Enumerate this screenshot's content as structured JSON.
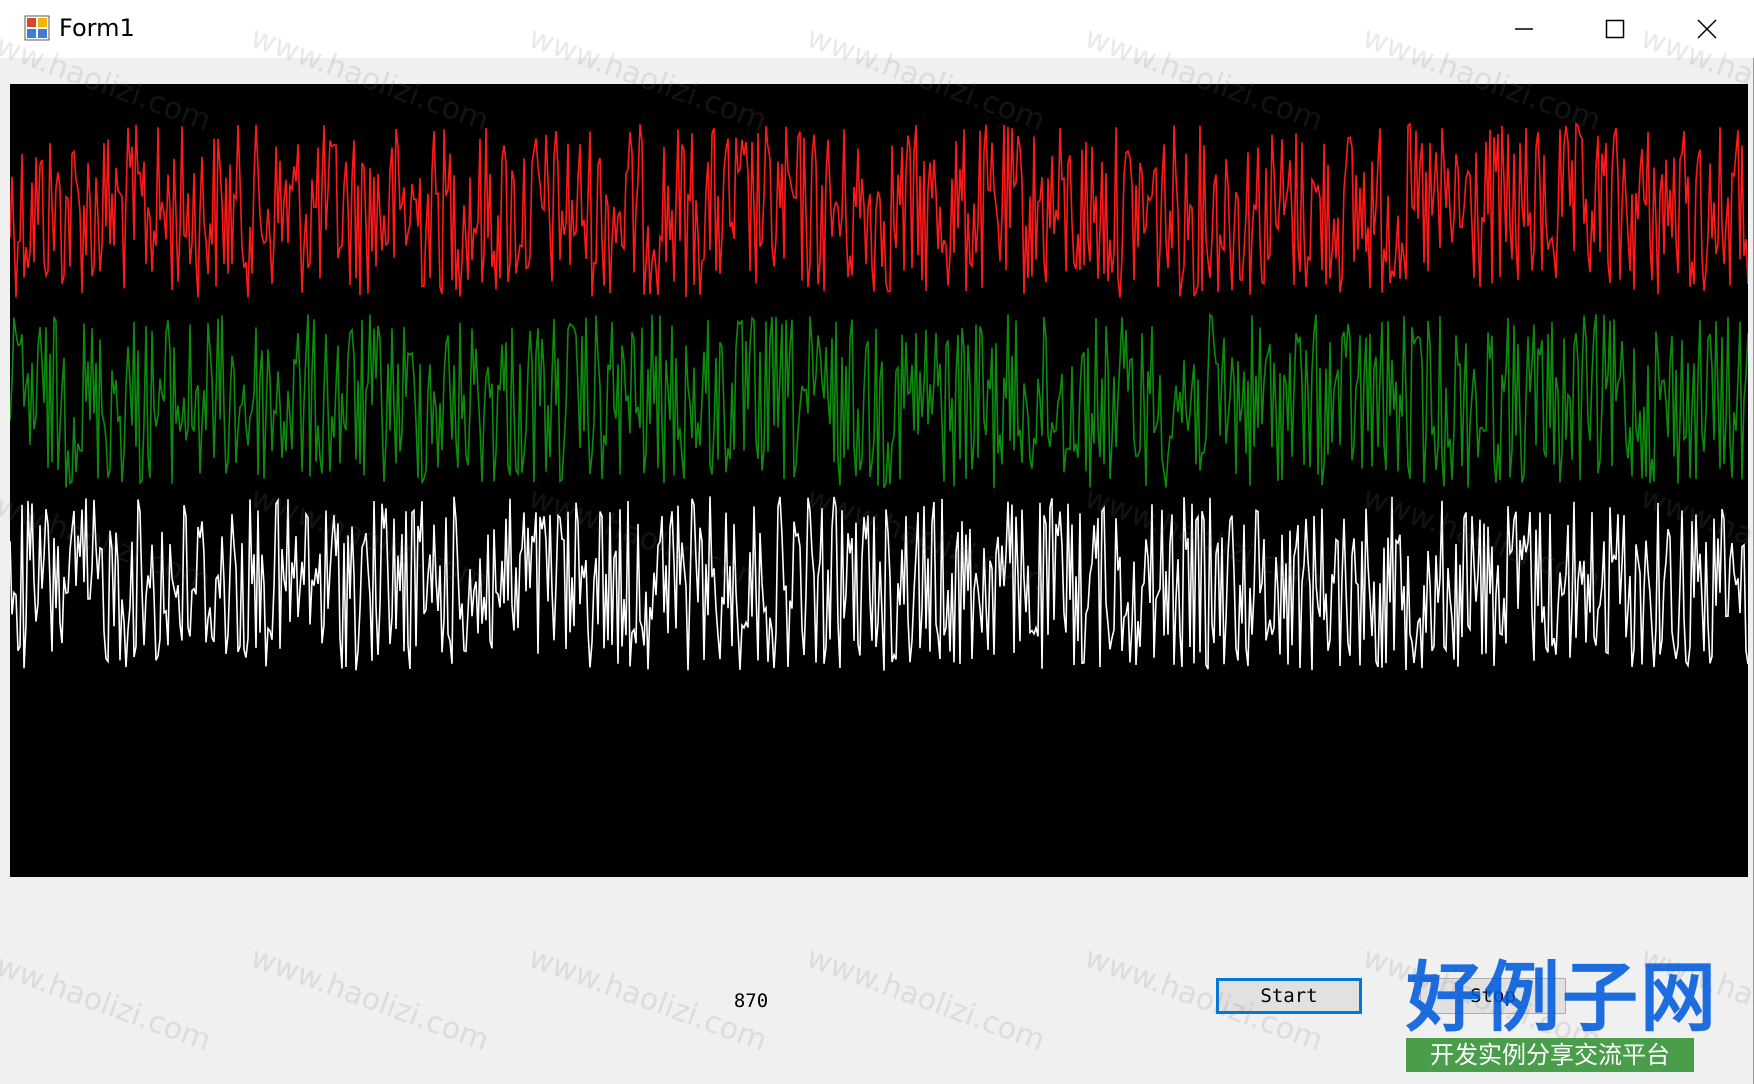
{
  "window": {
    "title": "Form1"
  },
  "titlebar_buttons": [
    {
      "name": "minimize",
      "icon": "minimize-icon"
    },
    {
      "name": "maximize",
      "icon": "maximize-icon"
    },
    {
      "name": "close",
      "icon": "close-icon"
    }
  ],
  "plot": {
    "background": "#000000",
    "series": [
      {
        "color": "#ff1a1a",
        "band_center": 0.16,
        "band_amplitude": 0.11
      },
      {
        "color": "#0e8a0e",
        "band_center": 0.4,
        "band_amplitude": 0.11
      },
      {
        "color": "#ffffff",
        "band_center": 0.63,
        "band_amplitude": 0.11
      }
    ]
  },
  "counter": {
    "value": "870"
  },
  "buttons": {
    "start_label": "Start",
    "stop_label": "Stop"
  },
  "watermark": {
    "text": "www.haolizi.com",
    "logo_main": "好例子网",
    "logo_sub": "开发实例分享交流平台"
  },
  "colors": {
    "accent": "#0078d7",
    "window_bg": "#f0f0f0"
  }
}
